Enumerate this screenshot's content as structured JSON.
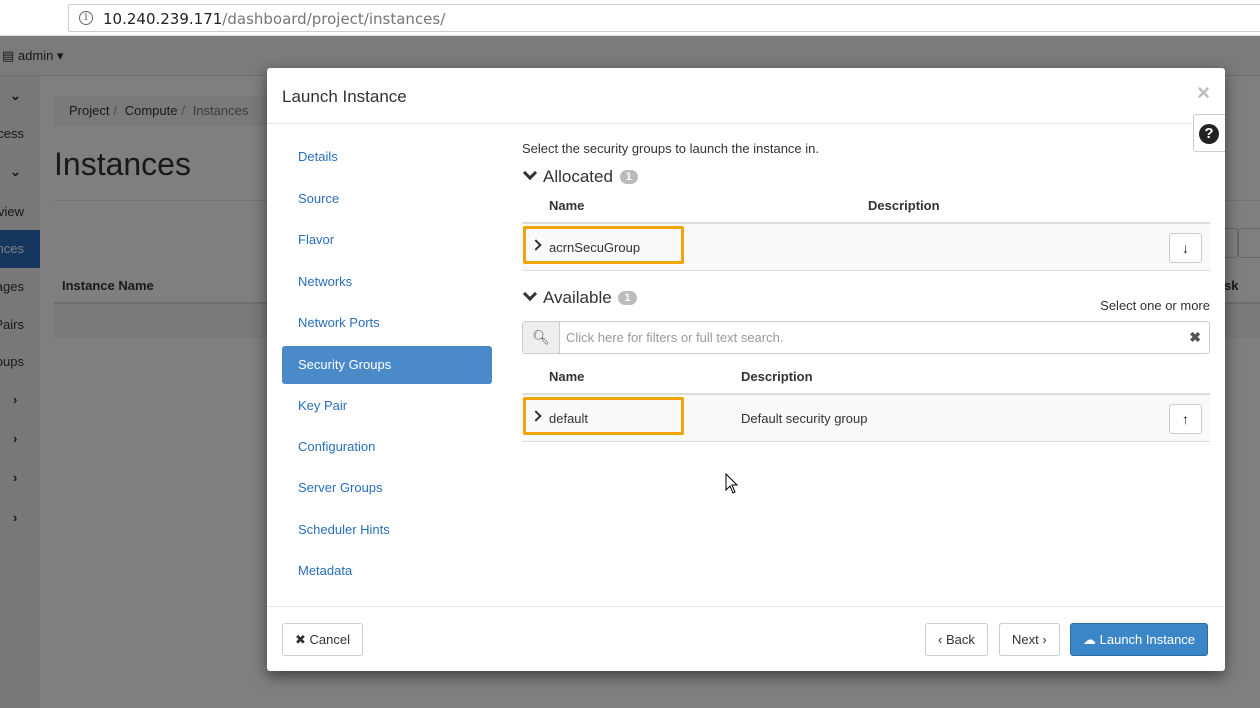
{
  "browser": {
    "url_host": "10.240.239.171",
    "url_path": "/dashboard/project/instances/"
  },
  "background": {
    "user_menu": "admin ▾",
    "sidebar_items": [
      "ccess",
      "view",
      "nces",
      "ages",
      "Pairs",
      "oups"
    ],
    "breadcrumb": [
      "Project",
      "Compute",
      "Instances"
    ],
    "page_title": "Instances",
    "table_header": "Instance Name",
    "partial_header": "sk"
  },
  "modal": {
    "title": "Launch Instance",
    "close_icon": "×",
    "help_icon": "?",
    "nav": [
      "Details",
      "Source",
      "Flavor",
      "Networks",
      "Network Ports",
      "Security Groups",
      "Key Pair",
      "Configuration",
      "Server Groups",
      "Scheduler Hints",
      "Metadata"
    ],
    "active_nav": "Security Groups",
    "intro": "Select the security groups to launch the instance in.",
    "allocated": {
      "heading": "Allocated",
      "count": "1",
      "col_name": "Name",
      "col_description": "Description",
      "rows": [
        {
          "name": "acrnSecuGroup",
          "description": ""
        }
      ]
    },
    "available": {
      "heading": "Available",
      "count": "1",
      "hint": "Select one or more",
      "search_placeholder": "Click here for filters or full text search.",
      "col_name": "Name",
      "col_description": "Description",
      "rows": [
        {
          "name": "default",
          "description": "Default security group"
        }
      ]
    },
    "footer": {
      "cancel": "Cancel",
      "back": "Back",
      "next": "Next",
      "launch": "Launch Instance"
    }
  },
  "colors": {
    "highlight": "#f0a30a",
    "primary": "#3b86c6",
    "nav_active": "#4a8ac9",
    "link": "#2a6ebb"
  }
}
